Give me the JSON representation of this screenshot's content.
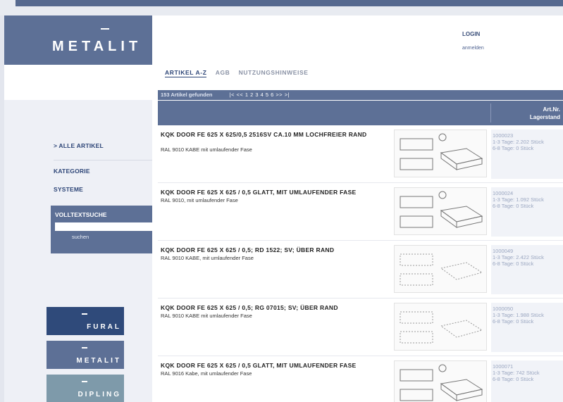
{
  "logo": "METALIT",
  "login": {
    "label": "LOGIN",
    "sub": "anmelden"
  },
  "tabs": [
    {
      "label": "ARTIKEL A-Z"
    },
    {
      "label": "AGB"
    },
    {
      "label": "NUTZUNGSHINWEISE"
    }
  ],
  "results": {
    "count_text": "153 Artikel gefunden",
    "pagination": "|< << 1 2 3 4 5 6 >> >|"
  },
  "header": {
    "artnr": "Art.Nr.",
    "stock": "Lagerstand"
  },
  "sidebar": {
    "all_articles": "> ALLE ARTIKEL",
    "category": "KATEGORIE",
    "systems": "SYSTEME",
    "search_title": "VOLLTEXTSUCHE",
    "search_button": "suchen",
    "search_value": ""
  },
  "brands": [
    "FURAL",
    "METALIT",
    "DIPLING"
  ],
  "products": [
    {
      "name": "KQK DOOR FE 625 X 625/0,5 2516SV CA.10 MM LOCHFREIER RAND",
      "desc": "RAL 9010 KABE mit umlaufender Fase",
      "artnr": "1000023",
      "stock1": "1-3 Tage: 2.202 Stück",
      "stock2": "6-8 Tage: 0 Stück"
    },
    {
      "name": "KQK DOOR FE 625 X 625 / 0,5 GLATT, MIT UMLAUFENDER FASE",
      "desc": "RAL 9010, mit umlaufender Fase",
      "artnr": "1000024",
      "stock1": "1-3 Tage: 1.092 Stück",
      "stock2": "6-8 Tage: 0 Stück"
    },
    {
      "name": "KQK DOOR FE 625 X 625 / 0,5; RD 1522; SV; ÜBER RAND",
      "desc": "RAL 9010 KABE, mit umlaufender Fase",
      "artnr": "1000049",
      "stock1": "1-3 Tage: 2.422 Stück",
      "stock2": "6-8 Tage: 0 Stück"
    },
    {
      "name": "KQK DOOR FE 625 X 625 / 0,5; RG 07015; SV; ÜBER RAND",
      "desc": "RAL 9010 KABE mit umlaufender Fase",
      "artnr": "1000050",
      "stock1": "1-3 Tage: 1.988 Stück",
      "stock2": "6-8 Tage: 0 Stück"
    },
    {
      "name": "KQK DOOR FE 625 X 625 / 0,5 GLATT, MIT UMLAUFENDER FASE",
      "desc": "RAL 9016 Kabe, mit umlaufender Fase",
      "artnr": "1000071",
      "stock1": "1-3 Tage: 742 Stück",
      "stock2": "6-8 Tage: 0 Stück"
    }
  ]
}
